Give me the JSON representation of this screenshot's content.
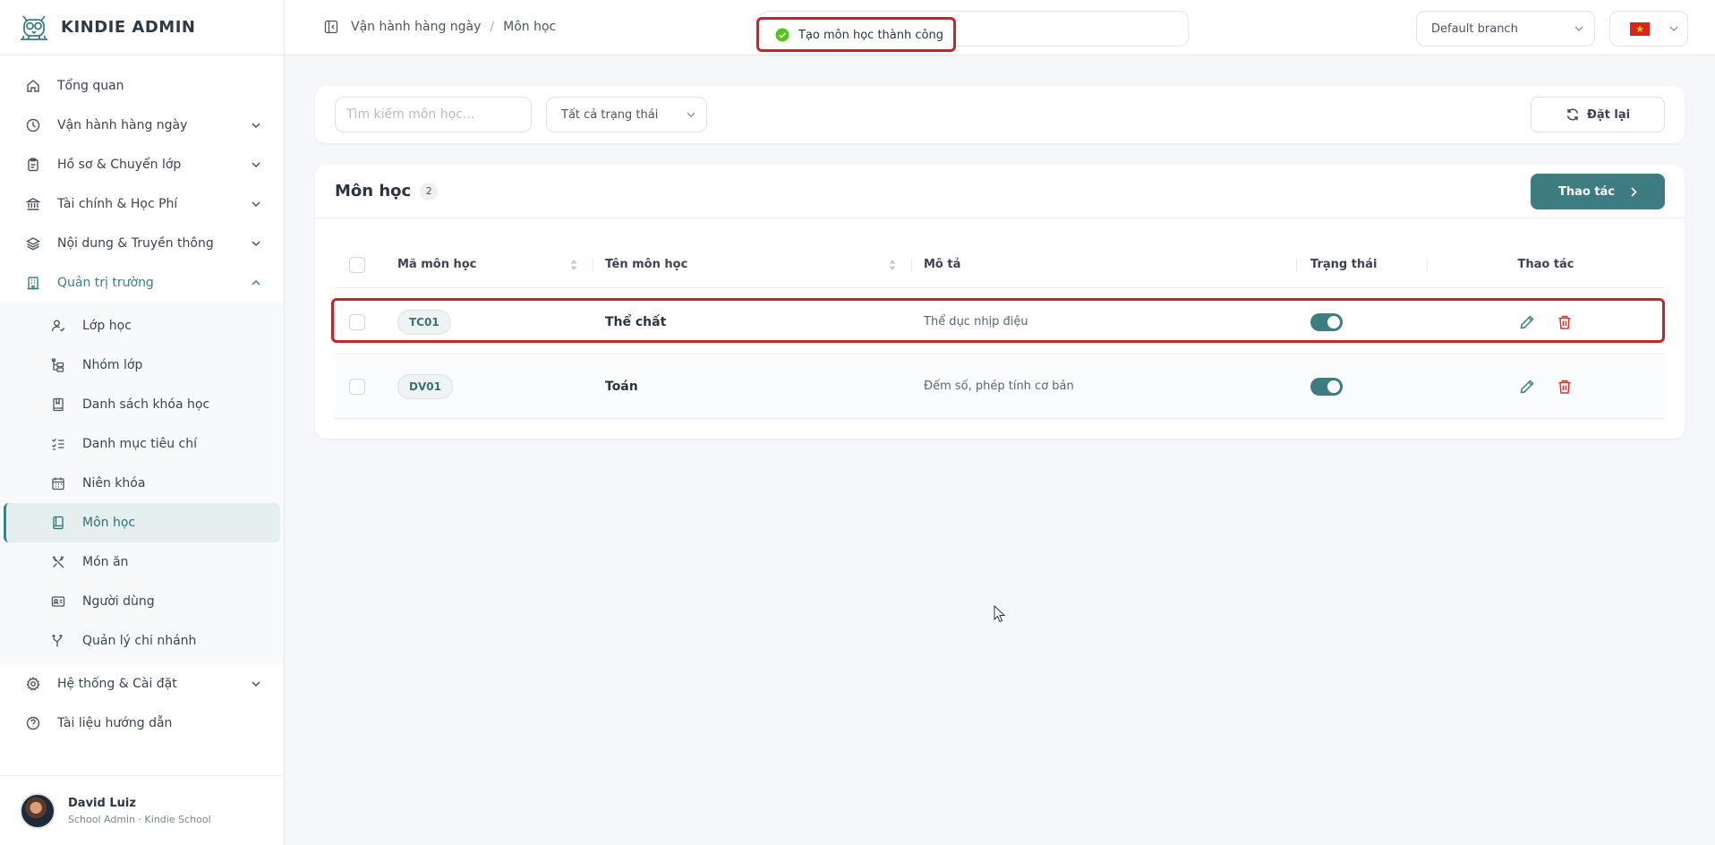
{
  "app": {
    "title": "KINDIE ADMIN"
  },
  "sidebar": {
    "items": [
      {
        "label": "Tổng quan",
        "icon": "home-icon"
      },
      {
        "label": "Vận hành hàng ngày",
        "icon": "clock-icon"
      },
      {
        "label": "Hồ sơ & Chuyển lớp",
        "icon": "clipboard-icon"
      },
      {
        "label": "Tài chính & Học Phí",
        "icon": "bank-icon"
      },
      {
        "label": "Nội dung & Truyền thông",
        "icon": "layers-icon"
      },
      {
        "label": "Quản trị trường",
        "icon": "building-icon"
      },
      {
        "label": "Hệ thống & Cài đặt",
        "icon": "gear-icon"
      },
      {
        "label": "Tài liệu hướng dẫn",
        "icon": "help-icon"
      }
    ],
    "sub_items": [
      {
        "label": "Lớp học",
        "icon": "user-check-icon"
      },
      {
        "label": "Nhóm lớp",
        "icon": "hierarchy-icon"
      },
      {
        "label": "Danh sách khóa học",
        "icon": "book-icon"
      },
      {
        "label": "Danh mục tiêu chí",
        "icon": "checklist-icon"
      },
      {
        "label": "Niên khóa",
        "icon": "calendar-icon"
      },
      {
        "label": "Môn học",
        "icon": "book-open-icon"
      },
      {
        "label": "Món ăn",
        "icon": "utensils-icon"
      },
      {
        "label": "Người dùng",
        "icon": "id-card-icon"
      },
      {
        "label": "Quản lý chi nhánh",
        "icon": "branch-icon"
      }
    ],
    "user": {
      "name": "David Luiz",
      "role": "School Admin · Kindie School"
    }
  },
  "header": {
    "breadcrumb": [
      "Vận hành hàng ngày",
      "Môn học"
    ],
    "branch": "Default branch"
  },
  "toast": {
    "message": "Tạo môn học thành công"
  },
  "filter": {
    "search_placeholder": "Tìm kiếm môn học...",
    "status": "Tất cả trạng thái",
    "reset": "Đặt lại"
  },
  "table": {
    "title": "Môn học",
    "count": "2",
    "actions_button": "Thao tác",
    "columns": [
      "Mã môn học",
      "Tên môn học",
      "Mô tả",
      "Trạng thái",
      "Thao tác"
    ],
    "rows": [
      {
        "code": "TC01",
        "name": "Thể chất",
        "description": "Thể dục nhịp điệu",
        "active": true
      },
      {
        "code": "DV01",
        "name": "Toán",
        "description": "Đếm số, phép tính cơ bản",
        "active": true
      }
    ]
  },
  "colors": {
    "accent": "#3d7d81",
    "highlight": "#c4242b",
    "success": "#52c41a",
    "danger": "#e03131"
  }
}
